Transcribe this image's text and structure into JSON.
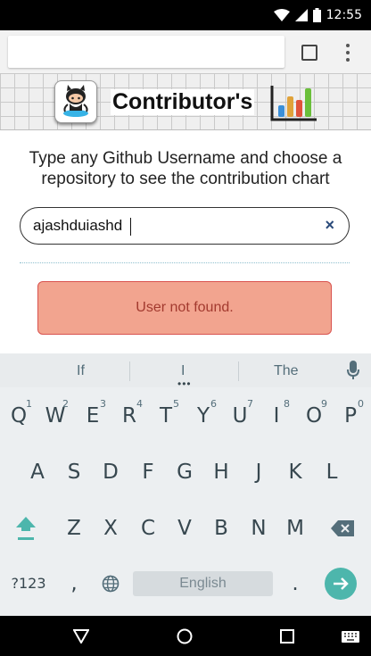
{
  "status_bar": {
    "time": "12:55"
  },
  "header": {
    "title": "Contributor's"
  },
  "intro": {
    "text": "Type any Github Username and choose a repository to see the contribution chart"
  },
  "search": {
    "value": "ajashduiashd",
    "clear_icon": "×"
  },
  "alert": {
    "message": "User not found.",
    "color": "#f2a48f"
  },
  "keyboard": {
    "suggestions": [
      "If",
      "I",
      "The"
    ],
    "row1": [
      {
        "label": "Q",
        "hint": "1"
      },
      {
        "label": "W",
        "hint": "2"
      },
      {
        "label": "E",
        "hint": "3"
      },
      {
        "label": "R",
        "hint": "4"
      },
      {
        "label": "T",
        "hint": "5"
      },
      {
        "label": "Y",
        "hint": "6"
      },
      {
        "label": "U",
        "hint": "7"
      },
      {
        "label": "I",
        "hint": "8"
      },
      {
        "label": "O",
        "hint": "9"
      },
      {
        "label": "P",
        "hint": "0"
      }
    ],
    "row2": [
      "A",
      "S",
      "D",
      "F",
      "G",
      "H",
      "J",
      "K",
      "L"
    ],
    "row3": [
      "Z",
      "X",
      "C",
      "V",
      "B",
      "N",
      "M"
    ],
    "symbols_label": "?123",
    "comma": ",",
    "space_label": "English",
    "period": ".",
    "accent_color": "#4db6ac"
  }
}
